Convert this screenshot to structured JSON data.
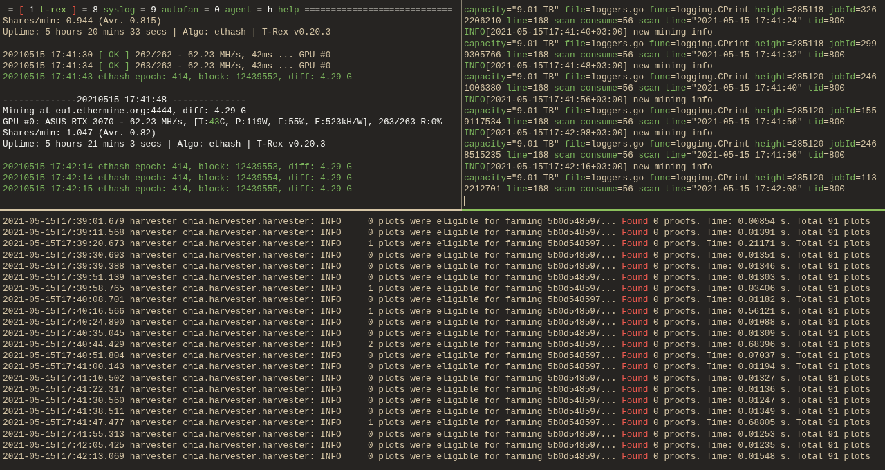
{
  "status_bar": {
    "separator": "=",
    "open_bracket": "[",
    "close_bracket": "]",
    "fill": "============================",
    "tabs": [
      {
        "key": "1",
        "label": "t-rex",
        "selected": true
      },
      {
        "key": "8",
        "label": "syslog",
        "selected": false
      },
      {
        "key": "9",
        "label": "autofan",
        "selected": false
      },
      {
        "key": "0",
        "label": "agent",
        "selected": false
      },
      {
        "key": "h",
        "label": "help",
        "selected": false
      }
    ]
  },
  "miner_pane": {
    "blocks": [
      [
        [
          {
            "kind": "text",
            "text": "Shares/min: 0.944 (Avr. 0.815)"
          }
        ],
        [
          {
            "kind": "text",
            "text": "Uptime: 5 hours 20 mins 33 secs | Algo: ethash | T-Rex v0.20.3"
          }
        ]
      ],
      [
        [
          {
            "kind": "text",
            "text": "20210515 17:41:30 "
          },
          {
            "kind": "green",
            "text": "[ OK ]"
          },
          {
            "kind": "text",
            "text": " 262/262 - 62.23 MH/s, 42ms ... GPU #0"
          }
        ],
        [
          {
            "kind": "text",
            "text": "20210515 17:41:34 "
          },
          {
            "kind": "green",
            "text": "[ OK ]"
          },
          {
            "kind": "text",
            "text": " 263/263 - 62.23 MH/s, 43ms ... GPU #0"
          }
        ],
        [
          {
            "kind": "green",
            "text": "20210515 17:41:43 ethash epoch: 414, block: 12439552, diff: 4.29 G"
          }
        ]
      ],
      [
        [
          {
            "kind": "bright",
            "text": "--------------20210515 17:41:48 --------------"
          }
        ],
        [
          {
            "kind": "bright",
            "text": "Mining at eu1.ethermine.org:4444, diff: 4.29 G"
          }
        ],
        [
          {
            "kind": "bright",
            "text": "GPU #0: ASUS RTX 3070 - 62.23 MH/s, [T:"
          },
          {
            "kind": "green",
            "text": "43"
          },
          {
            "kind": "bright",
            "text": "C, P:119W, F:55%, E:523kH/W], 263/263 R:0%"
          }
        ],
        [
          {
            "kind": "bright",
            "text": "Shares/min: 1.047 (Avr. 0.82)"
          }
        ],
        [
          {
            "kind": "bright",
            "text": "Uptime: 5 hours 21 mins 3 secs | Algo: ethash | T-Rex v0.20.3"
          }
        ]
      ],
      [
        [
          {
            "kind": "green",
            "text": "20210515 17:42:14 ethash epoch: 414, block: 12439553, diff: 4.29 G"
          }
        ],
        [
          {
            "kind": "green",
            "text": "20210515 17:42:14 ethash epoch: 414, block: 12439554, diff: 4.29 G"
          }
        ],
        [
          {
            "kind": "green",
            "text": "20210515 17:42:15 ethash epoch: 414, block: 12439555, diff: 4.29 G"
          }
        ]
      ]
    ]
  },
  "logger_pane": {
    "cursor": true,
    "lines": [
      [
        {
          "kind": "green",
          "text": "capacity"
        },
        {
          "kind": "text",
          "text": "=\"9.01 TB\" "
        },
        {
          "kind": "green",
          "text": "file"
        },
        {
          "kind": "text",
          "text": "=loggers.go "
        },
        {
          "kind": "green",
          "text": "func"
        },
        {
          "kind": "text",
          "text": "=logging.CPrint "
        },
        {
          "kind": "green",
          "text": "height"
        },
        {
          "kind": "text",
          "text": "=285118 "
        },
        {
          "kind": "green",
          "text": "jobId"
        },
        {
          "kind": "text",
          "text": "=326"
        }
      ],
      [
        {
          "kind": "text",
          "text": "2206210 "
        },
        {
          "kind": "green",
          "text": "line"
        },
        {
          "kind": "text",
          "text": "=168 "
        },
        {
          "kind": "green",
          "text": "scan consume"
        },
        {
          "kind": "text",
          "text": "=56 "
        },
        {
          "kind": "green",
          "text": "scan time"
        },
        {
          "kind": "text",
          "text": "=\"2021-05-15 17:41:24\" "
        },
        {
          "kind": "green",
          "text": "tid"
        },
        {
          "kind": "text",
          "text": "=800"
        }
      ],
      [
        {
          "kind": "green",
          "text": "INFO"
        },
        {
          "kind": "text",
          "text": "[2021-05-15T17:41:40+03:00] new mining info"
        }
      ],
      [
        {
          "kind": "green",
          "text": "capacity"
        },
        {
          "kind": "text",
          "text": "=\"9.01 TB\" "
        },
        {
          "kind": "green",
          "text": "file"
        },
        {
          "kind": "text",
          "text": "=loggers.go "
        },
        {
          "kind": "green",
          "text": "func"
        },
        {
          "kind": "text",
          "text": "=logging.CPrint "
        },
        {
          "kind": "green",
          "text": "height"
        },
        {
          "kind": "text",
          "text": "=285118 "
        },
        {
          "kind": "green",
          "text": "jobId"
        },
        {
          "kind": "text",
          "text": "=299"
        }
      ],
      [
        {
          "kind": "text",
          "text": "9305766 "
        },
        {
          "kind": "green",
          "text": "line"
        },
        {
          "kind": "text",
          "text": "=168 "
        },
        {
          "kind": "green",
          "text": "scan consume"
        },
        {
          "kind": "text",
          "text": "=56 "
        },
        {
          "kind": "green",
          "text": "scan time"
        },
        {
          "kind": "text",
          "text": "=\"2021-05-15 17:41:32\" "
        },
        {
          "kind": "green",
          "text": "tid"
        },
        {
          "kind": "text",
          "text": "=800"
        }
      ],
      [
        {
          "kind": "green",
          "text": "INFO"
        },
        {
          "kind": "text",
          "text": "[2021-05-15T17:41:48+03:00] new mining info"
        }
      ],
      [
        {
          "kind": "green",
          "text": "capacity"
        },
        {
          "kind": "text",
          "text": "=\"9.01 TB\" "
        },
        {
          "kind": "green",
          "text": "file"
        },
        {
          "kind": "text",
          "text": "=loggers.go "
        },
        {
          "kind": "green",
          "text": "func"
        },
        {
          "kind": "text",
          "text": "=logging.CPrint "
        },
        {
          "kind": "green",
          "text": "height"
        },
        {
          "kind": "text",
          "text": "=285120 "
        },
        {
          "kind": "green",
          "text": "jobId"
        },
        {
          "kind": "text",
          "text": "=246"
        }
      ],
      [
        {
          "kind": "text",
          "text": "1006380 "
        },
        {
          "kind": "green",
          "text": "line"
        },
        {
          "kind": "text",
          "text": "=168 "
        },
        {
          "kind": "green",
          "text": "scan consume"
        },
        {
          "kind": "text",
          "text": "=56 "
        },
        {
          "kind": "green",
          "text": "scan time"
        },
        {
          "kind": "text",
          "text": "=\"2021-05-15 17:41:40\" "
        },
        {
          "kind": "green",
          "text": "tid"
        },
        {
          "kind": "text",
          "text": "=800"
        }
      ],
      [
        {
          "kind": "green",
          "text": "INFO"
        },
        {
          "kind": "text",
          "text": "[2021-05-15T17:41:56+03:00] new mining info"
        }
      ],
      [
        {
          "kind": "green",
          "text": "capacity"
        },
        {
          "kind": "text",
          "text": "=\"9.01 TB\" "
        },
        {
          "kind": "green",
          "text": "file"
        },
        {
          "kind": "text",
          "text": "=loggers.go "
        },
        {
          "kind": "green",
          "text": "func"
        },
        {
          "kind": "text",
          "text": "=logging.CPrint "
        },
        {
          "kind": "green",
          "text": "height"
        },
        {
          "kind": "text",
          "text": "=285120 "
        },
        {
          "kind": "green",
          "text": "jobId"
        },
        {
          "kind": "text",
          "text": "=155"
        }
      ],
      [
        {
          "kind": "text",
          "text": "9117534 "
        },
        {
          "kind": "green",
          "text": "line"
        },
        {
          "kind": "text",
          "text": "=168 "
        },
        {
          "kind": "green",
          "text": "scan consume"
        },
        {
          "kind": "text",
          "text": "=56 "
        },
        {
          "kind": "green",
          "text": "scan time"
        },
        {
          "kind": "text",
          "text": "=\"2021-05-15 17:41:56\" "
        },
        {
          "kind": "green",
          "text": "tid"
        },
        {
          "kind": "text",
          "text": "=800"
        }
      ],
      [
        {
          "kind": "green",
          "text": "INFO"
        },
        {
          "kind": "text",
          "text": "[2021-05-15T17:42:08+03:00] new mining info"
        }
      ],
      [
        {
          "kind": "green",
          "text": "capacity"
        },
        {
          "kind": "text",
          "text": "=\"9.01 TB\" "
        },
        {
          "kind": "green",
          "text": "file"
        },
        {
          "kind": "text",
          "text": "=loggers.go "
        },
        {
          "kind": "green",
          "text": "func"
        },
        {
          "kind": "text",
          "text": "=logging.CPrint "
        },
        {
          "kind": "green",
          "text": "height"
        },
        {
          "kind": "text",
          "text": "=285120 "
        },
        {
          "kind": "green",
          "text": "jobId"
        },
        {
          "kind": "text",
          "text": "=246"
        }
      ],
      [
        {
          "kind": "text",
          "text": "8515235 "
        },
        {
          "kind": "green",
          "text": "line"
        },
        {
          "kind": "text",
          "text": "=168 "
        },
        {
          "kind": "green",
          "text": "scan consume"
        },
        {
          "kind": "text",
          "text": "=56 "
        },
        {
          "kind": "green",
          "text": "scan time"
        },
        {
          "kind": "text",
          "text": "=\"2021-05-15 17:41:56\" "
        },
        {
          "kind": "green",
          "text": "tid"
        },
        {
          "kind": "text",
          "text": "=800"
        }
      ],
      [
        {
          "kind": "green",
          "text": "INFO"
        },
        {
          "kind": "text",
          "text": "[2021-05-15T17:42:16+03:00] new mining info"
        }
      ],
      [
        {
          "kind": "green",
          "text": "capacity"
        },
        {
          "kind": "text",
          "text": "=\"9.01 TB\" "
        },
        {
          "kind": "green",
          "text": "file"
        },
        {
          "kind": "text",
          "text": "=loggers.go "
        },
        {
          "kind": "green",
          "text": "func"
        },
        {
          "kind": "text",
          "text": "=logging.CPrint "
        },
        {
          "kind": "green",
          "text": "height"
        },
        {
          "kind": "text",
          "text": "=285120 "
        },
        {
          "kind": "green",
          "text": "jobId"
        },
        {
          "kind": "text",
          "text": "=113"
        }
      ],
      [
        {
          "kind": "text",
          "text": "2212701 "
        },
        {
          "kind": "green",
          "text": "line"
        },
        {
          "kind": "text",
          "text": "=168 "
        },
        {
          "kind": "green",
          "text": "scan consume"
        },
        {
          "kind": "text",
          "text": "=56 "
        },
        {
          "kind": "green",
          "text": "scan time"
        },
        {
          "kind": "text",
          "text": "=\"2021-05-15 17:42:08\" "
        },
        {
          "kind": "green",
          "text": "tid"
        },
        {
          "kind": "text",
          "text": "=800"
        }
      ]
    ]
  },
  "harvester_pane": {
    "lines": [
      [
        {
          "kind": "text",
          "text": "2021-05-15T17:39:01.679 harvester chia.harvester.harvester: INFO     0 plots were eligible for farming 5b0d548597... "
        },
        {
          "kind": "red",
          "text": "Found"
        },
        {
          "kind": "text",
          "text": " 0 proofs. Time: 0.00854 s. Total 91 plots"
        }
      ],
      [
        {
          "kind": "text",
          "text": "2021-05-15T17:39:11.568 harvester chia.harvester.harvester: INFO     0 plots were eligible for farming 5b0d548597... "
        },
        {
          "kind": "red",
          "text": "Found"
        },
        {
          "kind": "text",
          "text": " 0 proofs. Time: 0.01391 s. Total 91 plots"
        }
      ],
      [
        {
          "kind": "text",
          "text": "2021-05-15T17:39:20.673 harvester chia.harvester.harvester: INFO     1 plots were eligible for farming 5b0d548597... "
        },
        {
          "kind": "red",
          "text": "Found"
        },
        {
          "kind": "text",
          "text": " 0 proofs. Time: 0.21171 s. Total 91 plots"
        }
      ],
      [
        {
          "kind": "text",
          "text": "2021-05-15T17:39:30.693 harvester chia.harvester.harvester: INFO     0 plots were eligible for farming 5b0d548597... "
        },
        {
          "kind": "red",
          "text": "Found"
        },
        {
          "kind": "text",
          "text": " 0 proofs. Time: 0.01351 s. Total 91 plots"
        }
      ],
      [
        {
          "kind": "text",
          "text": "2021-05-15T17:39:39.388 harvester chia.harvester.harvester: INFO     0 plots were eligible for farming 5b0d548597... "
        },
        {
          "kind": "red",
          "text": "Found"
        },
        {
          "kind": "text",
          "text": " 0 proofs. Time: 0.01346 s. Total 91 plots"
        }
      ],
      [
        {
          "kind": "text",
          "text": "2021-05-15T17:39:51.139 harvester chia.harvester.harvester: INFO     0 plots were eligible for farming 5b0d548597... "
        },
        {
          "kind": "red",
          "text": "Found"
        },
        {
          "kind": "text",
          "text": " 0 proofs. Time: 0.01303 s. Total 91 plots"
        }
      ],
      [
        {
          "kind": "text",
          "text": "2021-05-15T17:39:58.765 harvester chia.harvester.harvester: INFO     1 plots were eligible for farming 5b0d548597... "
        },
        {
          "kind": "red",
          "text": "Found"
        },
        {
          "kind": "text",
          "text": " 0 proofs. Time: 0.03406 s. Total 91 plots"
        }
      ],
      [
        {
          "kind": "text",
          "text": "2021-05-15T17:40:08.701 harvester chia.harvester.harvester: INFO     0 plots were eligible for farming 5b0d548597... "
        },
        {
          "kind": "red",
          "text": "Found"
        },
        {
          "kind": "text",
          "text": " 0 proofs. Time: 0.01182 s. Total 91 plots"
        }
      ],
      [
        {
          "kind": "text",
          "text": "2021-05-15T17:40:16.566 harvester chia.harvester.harvester: INFO     1 plots were eligible for farming 5b0d548597... "
        },
        {
          "kind": "red",
          "text": "Found"
        },
        {
          "kind": "text",
          "text": " 0 proofs. Time: 0.56121 s. Total 91 plots"
        }
      ],
      [
        {
          "kind": "text",
          "text": "2021-05-15T17:40:24.890 harvester chia.harvester.harvester: INFO     0 plots were eligible for farming 5b0d548597... "
        },
        {
          "kind": "red",
          "text": "Found"
        },
        {
          "kind": "text",
          "text": " 0 proofs. Time: 0.01088 s. Total 91 plots"
        }
      ],
      [
        {
          "kind": "text",
          "text": "2021-05-15T17:40:35.045 harvester chia.harvester.harvester: INFO     0 plots were eligible for farming 5b0d548597... "
        },
        {
          "kind": "red",
          "text": "Found"
        },
        {
          "kind": "text",
          "text": " 0 proofs. Time: 0.01309 s. Total 91 plots"
        }
      ],
      [
        {
          "kind": "text",
          "text": "2021-05-15T17:40:44.429 harvester chia.harvester.harvester: INFO     2 plots were eligible for farming 5b0d548597... "
        },
        {
          "kind": "red",
          "text": "Found"
        },
        {
          "kind": "text",
          "text": " 0 proofs. Time: 0.68396 s. Total 91 plots"
        }
      ],
      [
        {
          "kind": "text",
          "text": "2021-05-15T17:40:51.804 harvester chia.harvester.harvester: INFO     0 plots were eligible for farming 5b0d548597... "
        },
        {
          "kind": "red",
          "text": "Found"
        },
        {
          "kind": "text",
          "text": " 0 proofs. Time: 0.07037 s. Total 91 plots"
        }
      ],
      [
        {
          "kind": "text",
          "text": "2021-05-15T17:41:00.143 harvester chia.harvester.harvester: INFO     0 plots were eligible for farming 5b0d548597... "
        },
        {
          "kind": "red",
          "text": "Found"
        },
        {
          "kind": "text",
          "text": " 0 proofs. Time: 0.01194 s. Total 91 plots"
        }
      ],
      [
        {
          "kind": "text",
          "text": "2021-05-15T17:41:10.502 harvester chia.harvester.harvester: INFO     0 plots were eligible for farming 5b0d548597... "
        },
        {
          "kind": "red",
          "text": "Found"
        },
        {
          "kind": "text",
          "text": " 0 proofs. Time: 0.01327 s. Total 91 plots"
        }
      ],
      [
        {
          "kind": "text",
          "text": "2021-05-15T17:41:22.317 harvester chia.harvester.harvester: INFO     0 plots were eligible for farming 5b0d548597... "
        },
        {
          "kind": "red",
          "text": "Found"
        },
        {
          "kind": "text",
          "text": " 0 proofs. Time: 0.01136 s. Total 91 plots"
        }
      ],
      [
        {
          "kind": "text",
          "text": "2021-05-15T17:41:30.560 harvester chia.harvester.harvester: INFO     0 plots were eligible for farming 5b0d548597... "
        },
        {
          "kind": "red",
          "text": "Found"
        },
        {
          "kind": "text",
          "text": " 0 proofs. Time: 0.01247 s. Total 91 plots"
        }
      ],
      [
        {
          "kind": "text",
          "text": "2021-05-15T17:41:38.511 harvester chia.harvester.harvester: INFO     0 plots were eligible for farming 5b0d548597... "
        },
        {
          "kind": "red",
          "text": "Found"
        },
        {
          "kind": "text",
          "text": " 0 proofs. Time: 0.01349 s. Total 91 plots"
        }
      ],
      [
        {
          "kind": "text",
          "text": "2021-05-15T17:41:47.477 harvester chia.harvester.harvester: INFO     1 plots were eligible for farming 5b0d548597... "
        },
        {
          "kind": "red",
          "text": "Found"
        },
        {
          "kind": "text",
          "text": " 0 proofs. Time: 0.68805 s. Total 91 plots"
        }
      ],
      [
        {
          "kind": "text",
          "text": "2021-05-15T17:41:55.313 harvester chia.harvester.harvester: INFO     0 plots were eligible for farming 5b0d548597... "
        },
        {
          "kind": "red",
          "text": "Found"
        },
        {
          "kind": "text",
          "text": " 0 proofs. Time: 0.01253 s. Total 91 plots"
        }
      ],
      [
        {
          "kind": "text",
          "text": "2021-05-15T17:42:05.425 harvester chia.harvester.harvester: INFO     0 plots were eligible for farming 5b0d548597... "
        },
        {
          "kind": "red",
          "text": "Found"
        },
        {
          "kind": "text",
          "text": " 0 proofs. Time: 0.01235 s. Total 91 plots"
        }
      ],
      [
        {
          "kind": "text",
          "text": "2021-05-15T17:42:13.069 harvester chia.harvester.harvester: INFO     0 plots were eligible for farming 5b0d548597... "
        },
        {
          "kind": "red",
          "text": "Found"
        },
        {
          "kind": "text",
          "text": " 0 proofs. Time: 0.01548 s. Total 91 plots"
        }
      ]
    ]
  }
}
